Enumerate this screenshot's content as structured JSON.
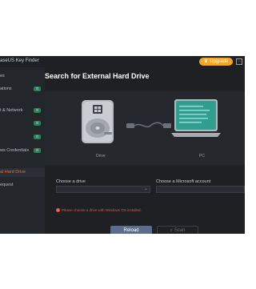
{
  "app": {
    "title": "aseUS Key Finder"
  },
  "header": {
    "upgrade_label": "Upgrade"
  },
  "sidebar": {
    "items": [
      {
        "label": "es",
        "badge": ""
      },
      {
        "label": "ations",
        "badge": "0"
      },
      {
        "label": "t & Network",
        "badge": "0"
      },
      {
        "label": "",
        "badge": "0"
      },
      {
        "label": "",
        "badge": "0"
      },
      {
        "label": "ws Credentials",
        "badge": "0"
      },
      {
        "label": "al Hard Drive",
        "badge": ""
      },
      {
        "label": "equest",
        "badge": ""
      }
    ],
    "active_index": 6
  },
  "main": {
    "title": "Search for External Hard Drive",
    "drive_caption": "Drive",
    "pc_caption": "PC",
    "choose_drive_label": "Choose a drive",
    "choose_account_label": "Choose a Microsoft account",
    "warning": "Please choose a drive with Windows OS installed.",
    "reload_label": "Reload",
    "scan_label": "Scan"
  },
  "colors": {
    "accent": "#f5a623",
    "active_item": "#e8742a",
    "badge": "#2f7d5a",
    "warning": "#e0553f",
    "primary_button": "#5b6d8a"
  },
  "icons": {
    "upgrade": "crown-icon",
    "warning": "warning-icon",
    "scan": "scan-icon",
    "select": "chevron-down-icon"
  }
}
